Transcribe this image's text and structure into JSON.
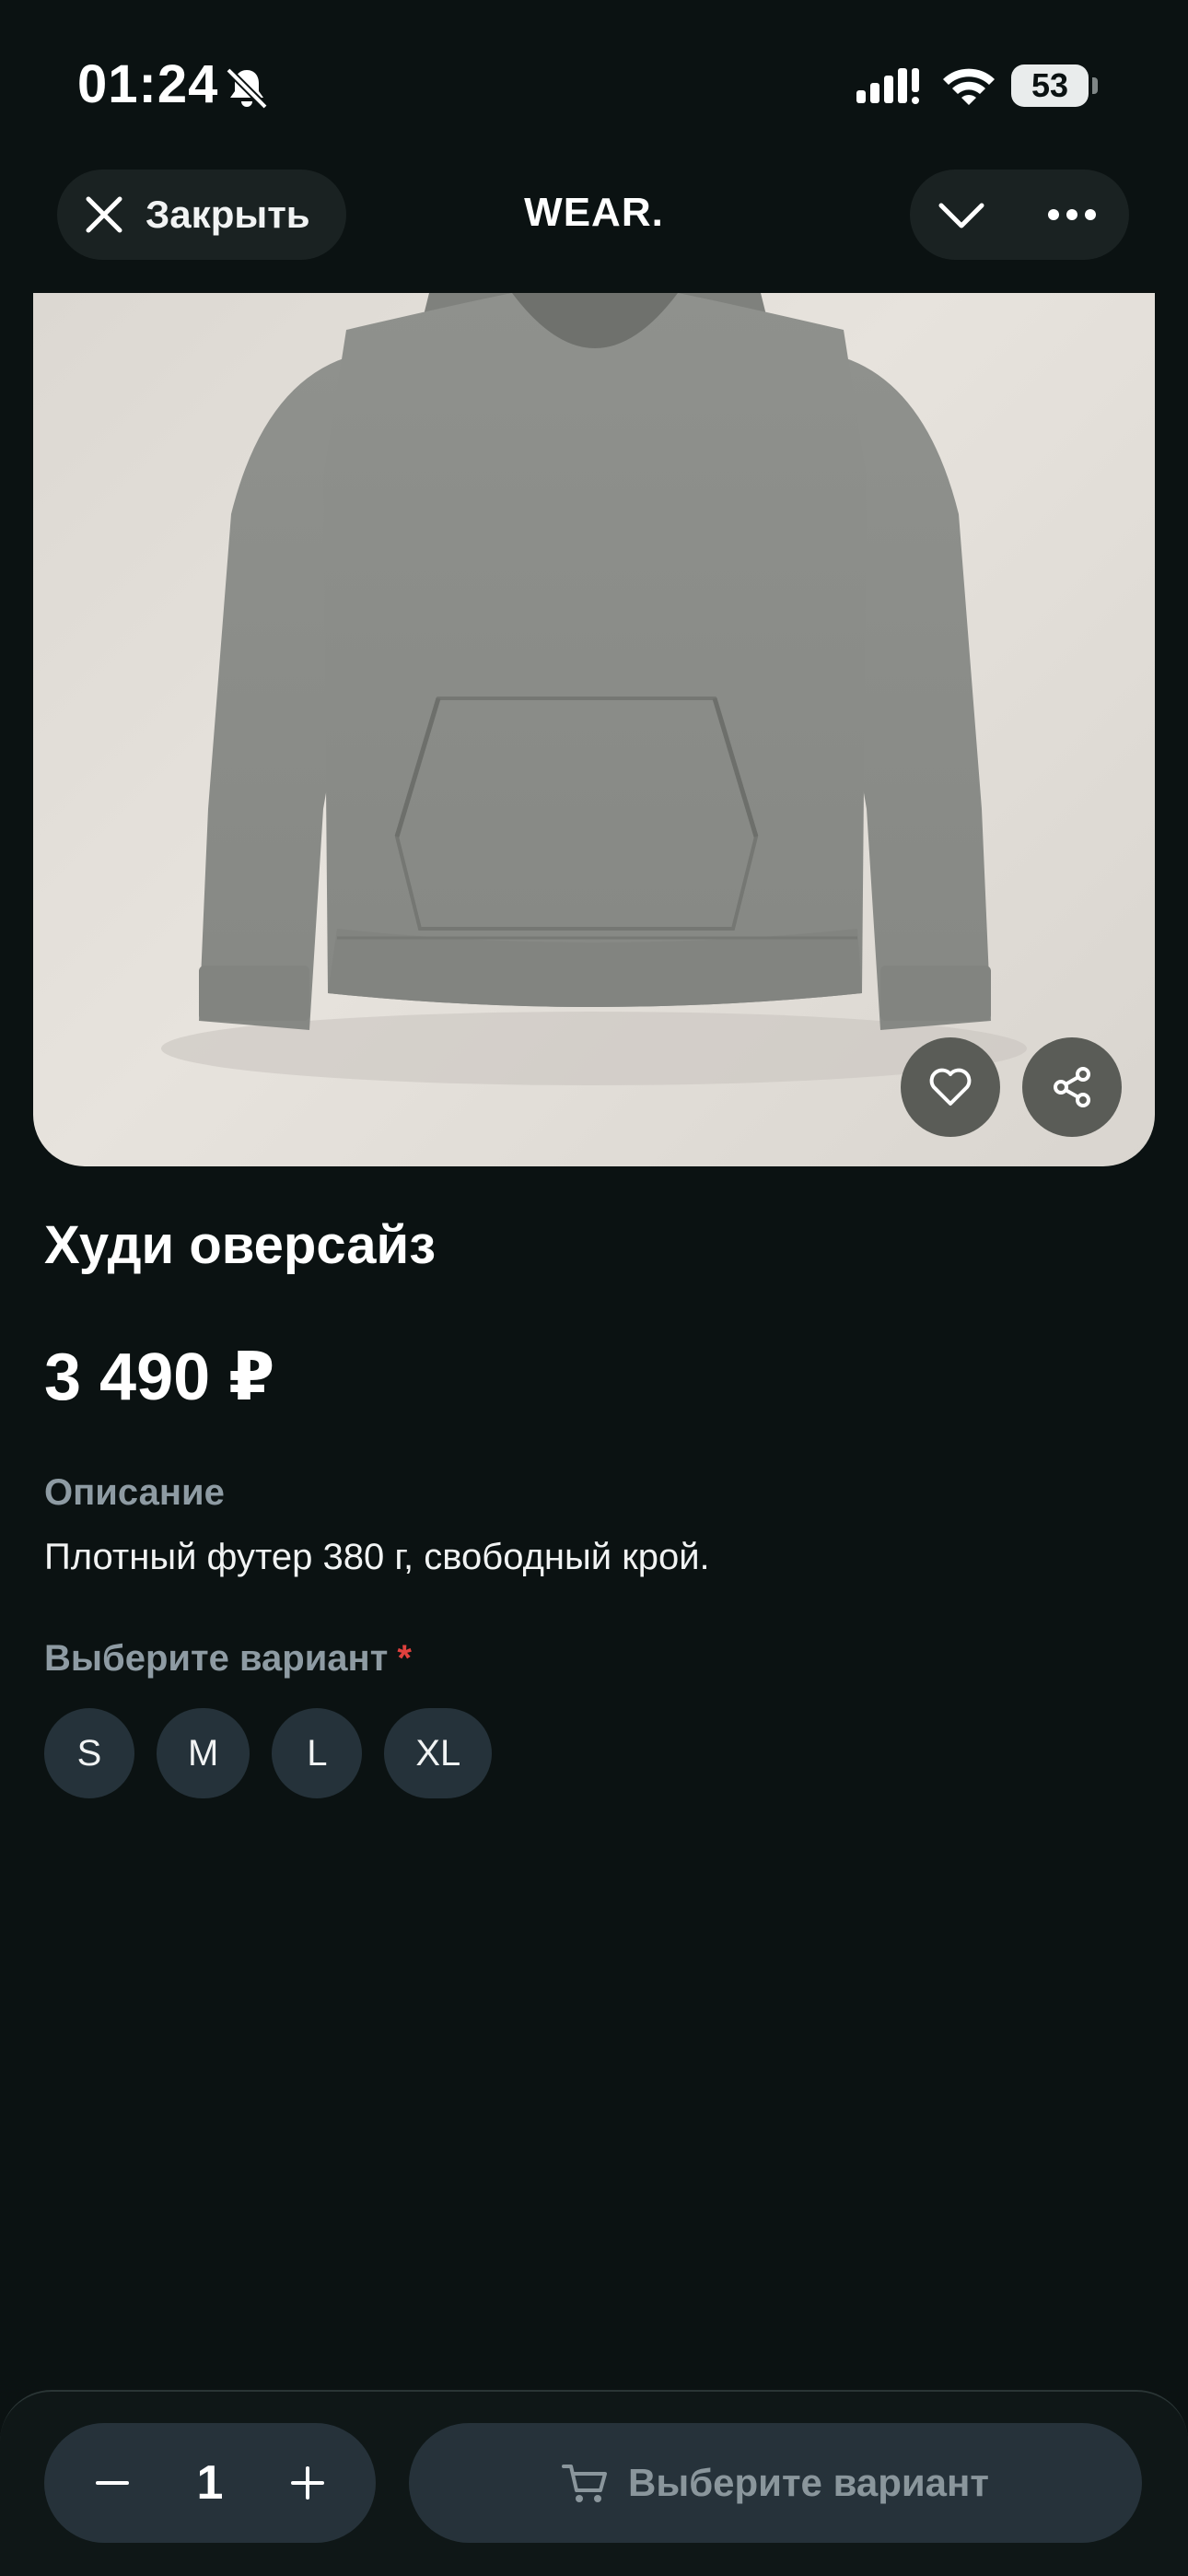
{
  "status_bar": {
    "time": "01:24",
    "battery": "53"
  },
  "header": {
    "close_label": "Закрыть",
    "brand": "WEAR."
  },
  "product": {
    "title": "Худи оверсайз",
    "price": "3 490 ₽",
    "description_label": "Описание",
    "description": "Плотный футер 380 г, свободный крой.",
    "variant_label": "Выберите вариант",
    "required_mark": "*",
    "variants": [
      "S",
      "M",
      "L",
      "XL"
    ]
  },
  "bottom_bar": {
    "quantity": "1",
    "cta_label": "Выберите вариант"
  },
  "icons": {
    "close": "close-icon",
    "bell": "bell-muted-icon",
    "signal": "signal-icon",
    "wifi": "wifi-icon",
    "chevron": "chevron-down-icon",
    "more": "more-icon",
    "heart": "heart-icon",
    "share": "share-icon",
    "minus": "minus-icon",
    "plus": "plus-icon",
    "cart": "cart-icon"
  },
  "colors": {
    "background": "#0b1212",
    "surface": "#26323a",
    "muted_text": "#8e9ba3",
    "required": "#e0413e"
  }
}
